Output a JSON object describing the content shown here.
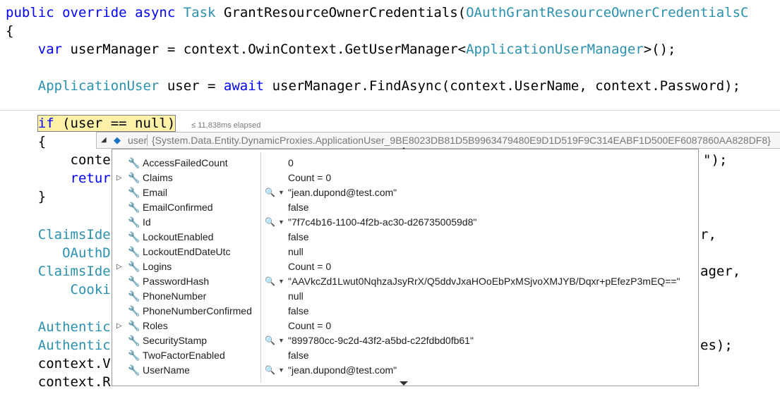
{
  "code": {
    "l1_public": "public",
    "l1_override": "override",
    "l1_async": "async",
    "l1_task": "Task",
    "l1_method": "GrantResourceOwnerCredentials(",
    "l1_param_type": "OAuthGrantResourceOwnerCredentialsC",
    "l2_brace": "{",
    "l3_var": "var",
    "l3_text": "userManager = context.OwinContext.GetUserManager<",
    "l3_type": "ApplicationUserManager",
    "l3_end": ">();",
    "l5_type": "ApplicationUser",
    "l5_text1": "user =",
    "l5_await": "await",
    "l5_text2": "userManager.FindAsync(context.UserName, context.Password);",
    "l7_if": "if",
    "l7_text": "(user == null)",
    "l7_elapsed": "≤ 11,838ms elapsed",
    "l8_brace": "{",
    "l9_text": "conte",
    "l9_tail": "\");",
    "l10_return": "retur",
    "l11_brace": "}",
    "l13_type": "ClaimsIde",
    "l13_tail": "r,",
    "l14_text": "OAuthD",
    "l15_type": "ClaimsIde",
    "l15_tail": "ager,",
    "l16_text": "Cooki",
    "l18_type": "Authentic",
    "l19_type": "Authentic",
    "l19_tail": "es);",
    "l20_text": "context.V",
    "l21_text": "context.R"
  },
  "tooltip": {
    "name": "user",
    "value": "{System.Data.Entity.DynamicProxies.ApplicationUser_9BE8023DB81D5B9963479480E9D1D519F9C314EABF1D500EF6087860AA828DF8}"
  },
  "properties": [
    {
      "name": "AccessFailedCount",
      "value": "0",
      "expandable": false,
      "viewer": false
    },
    {
      "name": "Claims",
      "value": "Count = 0",
      "expandable": true,
      "viewer": false
    },
    {
      "name": "Email",
      "value": "\"jean.dupond@test.com\"",
      "expandable": false,
      "viewer": true
    },
    {
      "name": "EmailConfirmed",
      "value": "false",
      "expandable": false,
      "viewer": false
    },
    {
      "name": "Id",
      "value": "\"7f7c4b16-1100-4f2b-ac30-d267350059d8\"",
      "expandable": false,
      "viewer": true
    },
    {
      "name": "LockoutEnabled",
      "value": "false",
      "expandable": false,
      "viewer": false
    },
    {
      "name": "LockoutEndDateUtc",
      "value": "null",
      "expandable": false,
      "viewer": false
    },
    {
      "name": "Logins",
      "value": "Count = 0",
      "expandable": true,
      "viewer": false
    },
    {
      "name": "PasswordHash",
      "value": "\"AAVkcZd1Lwut0NqhzaJsyRrX/Q5ddvJxaHOoEbPxMSjvoXMJYB/Dqxr+pEfezP3mEQ==\"",
      "expandable": false,
      "viewer": true
    },
    {
      "name": "PhoneNumber",
      "value": "null",
      "expandable": false,
      "viewer": false
    },
    {
      "name": "PhoneNumberConfirmed",
      "value": "false",
      "expandable": false,
      "viewer": false
    },
    {
      "name": "Roles",
      "value": "Count = 0",
      "expandable": true,
      "viewer": false
    },
    {
      "name": "SecurityStamp",
      "value": "\"899780cc-9c2d-43f2-a5bd-c22fdbd0fb61\"",
      "expandable": false,
      "viewer": true
    },
    {
      "name": "TwoFactorEnabled",
      "value": "false",
      "expandable": false,
      "viewer": false
    },
    {
      "name": "UserName",
      "value": "\"jean.dupond@test.com\"",
      "expandable": false,
      "viewer": true
    }
  ],
  "icons": {
    "wrench": "wrench-icon",
    "magnifier": "magnifier-icon",
    "expand": "expand-arrow-icon",
    "cube": "object-cube-icon"
  },
  "colors": {
    "keyword": "#0000ff",
    "type": "#2b91af",
    "highlight": "#fff2a8"
  }
}
